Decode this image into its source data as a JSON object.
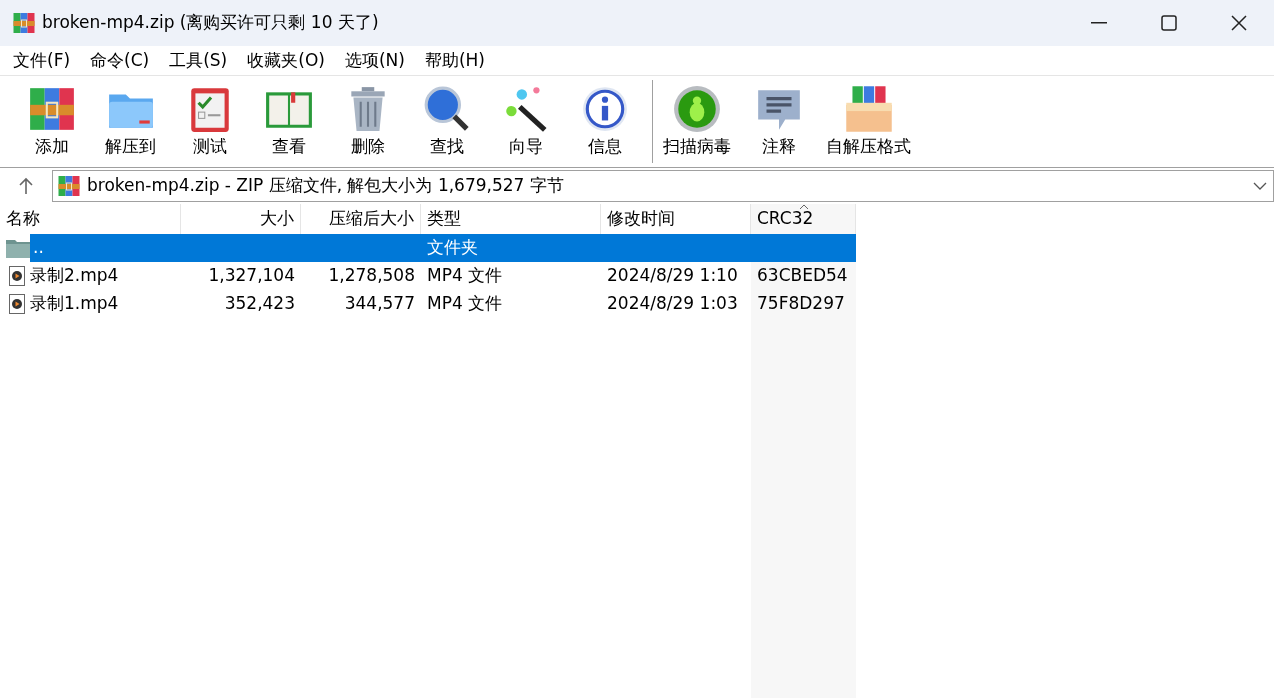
{
  "window": {
    "title": "broken-mp4.zip (离购买许可只剩 10 天了)"
  },
  "menu": [
    "文件(F)",
    "命令(C)",
    "工具(S)",
    "收藏夹(O)",
    "选项(N)",
    "帮助(H)"
  ],
  "toolbar_groups": [
    {
      "buttons": [
        {
          "kind": "add",
          "label": "添加"
        },
        {
          "kind": "extract",
          "label": "解压到"
        },
        {
          "kind": "test",
          "label": "测试"
        },
        {
          "kind": "view",
          "label": "查看"
        },
        {
          "kind": "delete",
          "label": "删除"
        },
        {
          "kind": "find",
          "label": "查找"
        },
        {
          "kind": "wizard",
          "label": "向导"
        },
        {
          "kind": "info",
          "label": "信息"
        }
      ]
    },
    {
      "buttons": [
        {
          "kind": "virus",
          "label": "扫描病毒"
        },
        {
          "kind": "comment",
          "label": "注释"
        },
        {
          "kind": "sfx",
          "label": "自解压格式"
        }
      ]
    }
  ],
  "address_bar": {
    "value": "broken-mp4.zip - ZIP 压缩文件, 解包大小为 1,679,527 字节"
  },
  "table": {
    "columns": [
      {
        "label": "名称",
        "sorted": false
      },
      {
        "label": "大小",
        "sorted": false
      },
      {
        "label": "压缩后大小",
        "sorted": false
      },
      {
        "label": "类型",
        "sorted": false
      },
      {
        "label": "修改时间",
        "sorted": false
      },
      {
        "label": "CRC32",
        "sorted": true
      }
    ],
    "rows": [
      {
        "kind": "folder",
        "selected": true,
        "cells": [
          "..",
          "",
          "",
          "文件夹",
          "",
          ""
        ]
      },
      {
        "kind": "video",
        "selected": false,
        "cells": [
          "录制2.mp4",
          "1,327,104",
          "1,278,508",
          "MP4 文件",
          "2024/8/29 1:10",
          "63CBED54"
        ]
      },
      {
        "kind": "video",
        "selected": false,
        "cells": [
          "录制1.mp4",
          "352,423",
          "344,577",
          "MP4 文件",
          "2024/8/29 1:03",
          "75F8D297"
        ]
      }
    ]
  }
}
